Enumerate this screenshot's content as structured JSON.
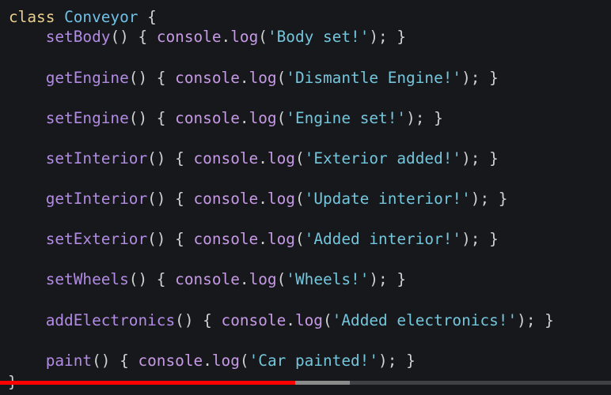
{
  "code": {
    "class_keyword": "class",
    "class_name": "Conveyor",
    "open_brace": " {",
    "close_brace": "}",
    "object_name": "console",
    "method_name": "log",
    "methods": [
      {
        "name": "setBody",
        "message": "'Body set!'"
      },
      {
        "name": "getEngine",
        "message": "'Dismantle Engine!'"
      },
      {
        "name": "setEngine",
        "message": "'Engine set!'"
      },
      {
        "name": "setInterior",
        "message": "'Exterior added!'"
      },
      {
        "name": "getInterior",
        "message": "'Update interior!'"
      },
      {
        "name": "setExterior",
        "message": "'Added interior!'"
      },
      {
        "name": "setWheels",
        "message": "'Wheels!'"
      },
      {
        "name": "addElectronics",
        "message": "'Added electronics!'"
      },
      {
        "name": "paint",
        "message": "'Car painted!'"
      }
    ]
  },
  "video_player": {
    "played_fraction": 0.483,
    "buffered_fraction": 0.573
  },
  "colors": {
    "background": "#17181c",
    "keyword": "#e9cf8e",
    "class_name": "#6fc2e6",
    "function_name": "#b28be4",
    "string": "#74c6dc",
    "progress_played": "#ff0000"
  }
}
